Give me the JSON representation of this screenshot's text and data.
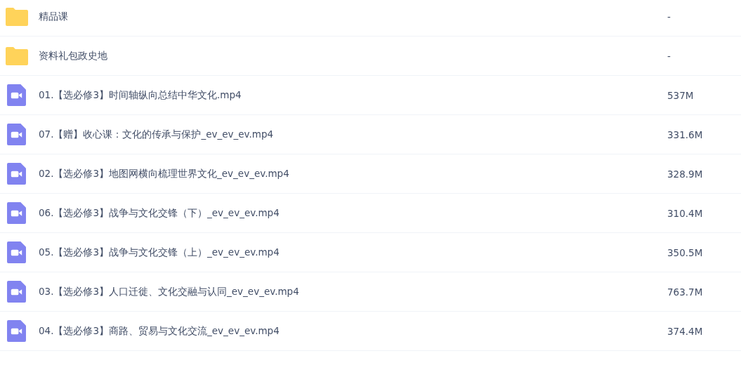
{
  "files": [
    {
      "kind": "folder",
      "name": "精品课",
      "size": "-"
    },
    {
      "kind": "folder",
      "name": "资料礼包政史地",
      "size": "-"
    },
    {
      "kind": "video",
      "name": "01.【选必修3】时间轴纵向总结中华文化.mp4",
      "size": "537M"
    },
    {
      "kind": "video",
      "name": "07.【赠】收心课：文化的传承与保护_ev_ev_ev.mp4",
      "size": "331.6M"
    },
    {
      "kind": "video",
      "name": "02.【选必修3】地图网横向梳理世界文化_ev_ev_ev.mp4",
      "size": "328.9M"
    },
    {
      "kind": "video",
      "name": "06.【选必修3】战争与文化交锋（下）_ev_ev_ev.mp4",
      "size": "310.4M"
    },
    {
      "kind": "video",
      "name": "05.【选必修3】战争与文化交锋（上）_ev_ev_ev.mp4",
      "size": "350.5M"
    },
    {
      "kind": "video",
      "name": "03.【选必修3】人口迁徙、文化交融与认同_ev_ev_ev.mp4",
      "size": "763.7M"
    },
    {
      "kind": "video",
      "name": "04.【选必修3】商路、贸易与文化交流_ev_ev_ev.mp4",
      "size": "374.4M"
    }
  ]
}
